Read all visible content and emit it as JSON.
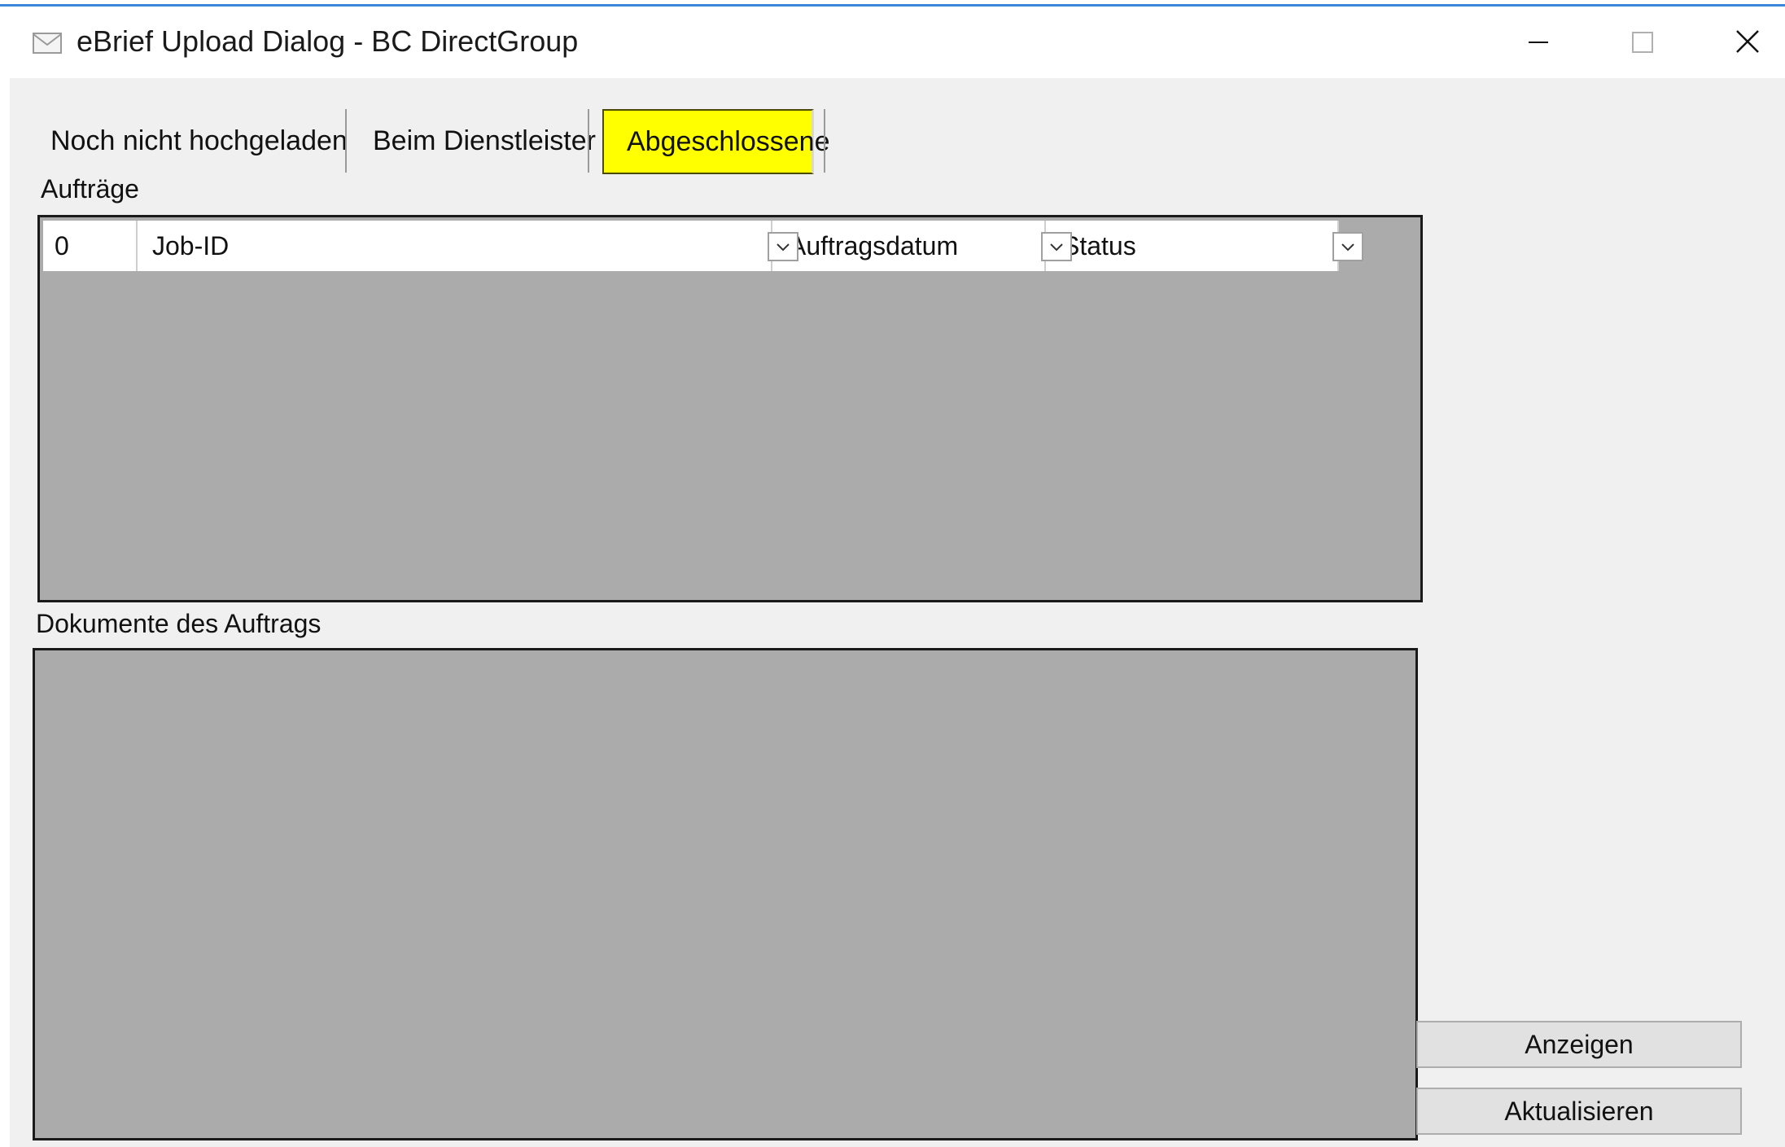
{
  "window": {
    "title": "eBrief Upload Dialog - BC DirectGroup",
    "icon": "envelope-icon",
    "accent_color": "#3a87d8"
  },
  "tabs": [
    {
      "label": "Noch nicht hochgeladen",
      "selected": false
    },
    {
      "label": "Beim Dienstleister",
      "selected": false
    },
    {
      "label": "Abgeschlossene",
      "selected": true,
      "highlight_color": "#ffff00"
    }
  ],
  "orders": {
    "label": "Aufträge",
    "columns": [
      {
        "label": "0"
      },
      {
        "label": "Job-ID"
      },
      {
        "label": "Auftragsdatum"
      },
      {
        "label": "Status"
      }
    ],
    "rows": [],
    "background_color": "#ababab"
  },
  "documents": {
    "label": "Dokumente des Auftrags",
    "rows": [],
    "background_color": "#ababab"
  },
  "buttons": {
    "show_label": "Anzeigen",
    "refresh_label": "Aktualisieren"
  }
}
